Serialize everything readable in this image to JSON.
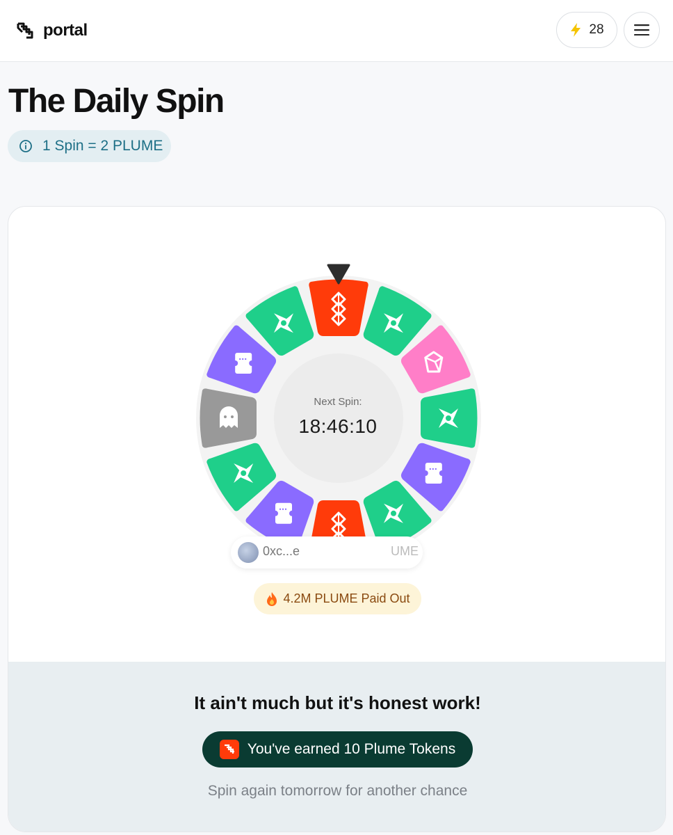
{
  "header": {
    "logo_text": "portal",
    "points_value": "28",
    "points_icon": "lightning-bolt-icon",
    "menu_icon": "hamburger-menu-icon"
  },
  "page": {
    "title": "The Daily Spin",
    "rate_badge": "1 Spin = 2 PLUME"
  },
  "wheel": {
    "countdown_label": "Next Spin:",
    "countdown_value": "18:46:10",
    "segments": [
      {
        "prize": "plume-logo",
        "color": "#ff3b0a"
      },
      {
        "prize": "shuriken",
        "color": "#1fcf8a"
      },
      {
        "prize": "gem",
        "color": "#ff7ec8"
      },
      {
        "prize": "shuriken",
        "color": "#1fcf8a"
      },
      {
        "prize": "ticket",
        "color": "#8a6bff"
      },
      {
        "prize": "shuriken",
        "color": "#1fcf8a"
      },
      {
        "prize": "plume-logo",
        "color": "#ff3b0a"
      },
      {
        "prize": "ticket",
        "color": "#8a6bff"
      },
      {
        "prize": "shuriken",
        "color": "#1fcf8a"
      },
      {
        "prize": "ghost",
        "color": "#999999"
      },
      {
        "prize": "ticket",
        "color": "#8a6bff"
      },
      {
        "prize": "shuriken",
        "color": "#1fcf8a"
      }
    ]
  },
  "ticker": {
    "address": "0xc...e",
    "amount": "UME"
  },
  "paid_out": "4.2M PLUME Paid Out",
  "result": {
    "title": "It ain't much but it's honest work!",
    "earned": "You've earned 10 Plume Tokens",
    "retry": "Spin again tomorrow for another chance"
  },
  "colors": {
    "accent_orange": "#ff3b0a",
    "green": "#1fcf8a",
    "purple": "#8a6bff",
    "pink": "#ff7ec8",
    "dark_teal": "#0a3b32",
    "badge_teal": "#1d6f86"
  }
}
